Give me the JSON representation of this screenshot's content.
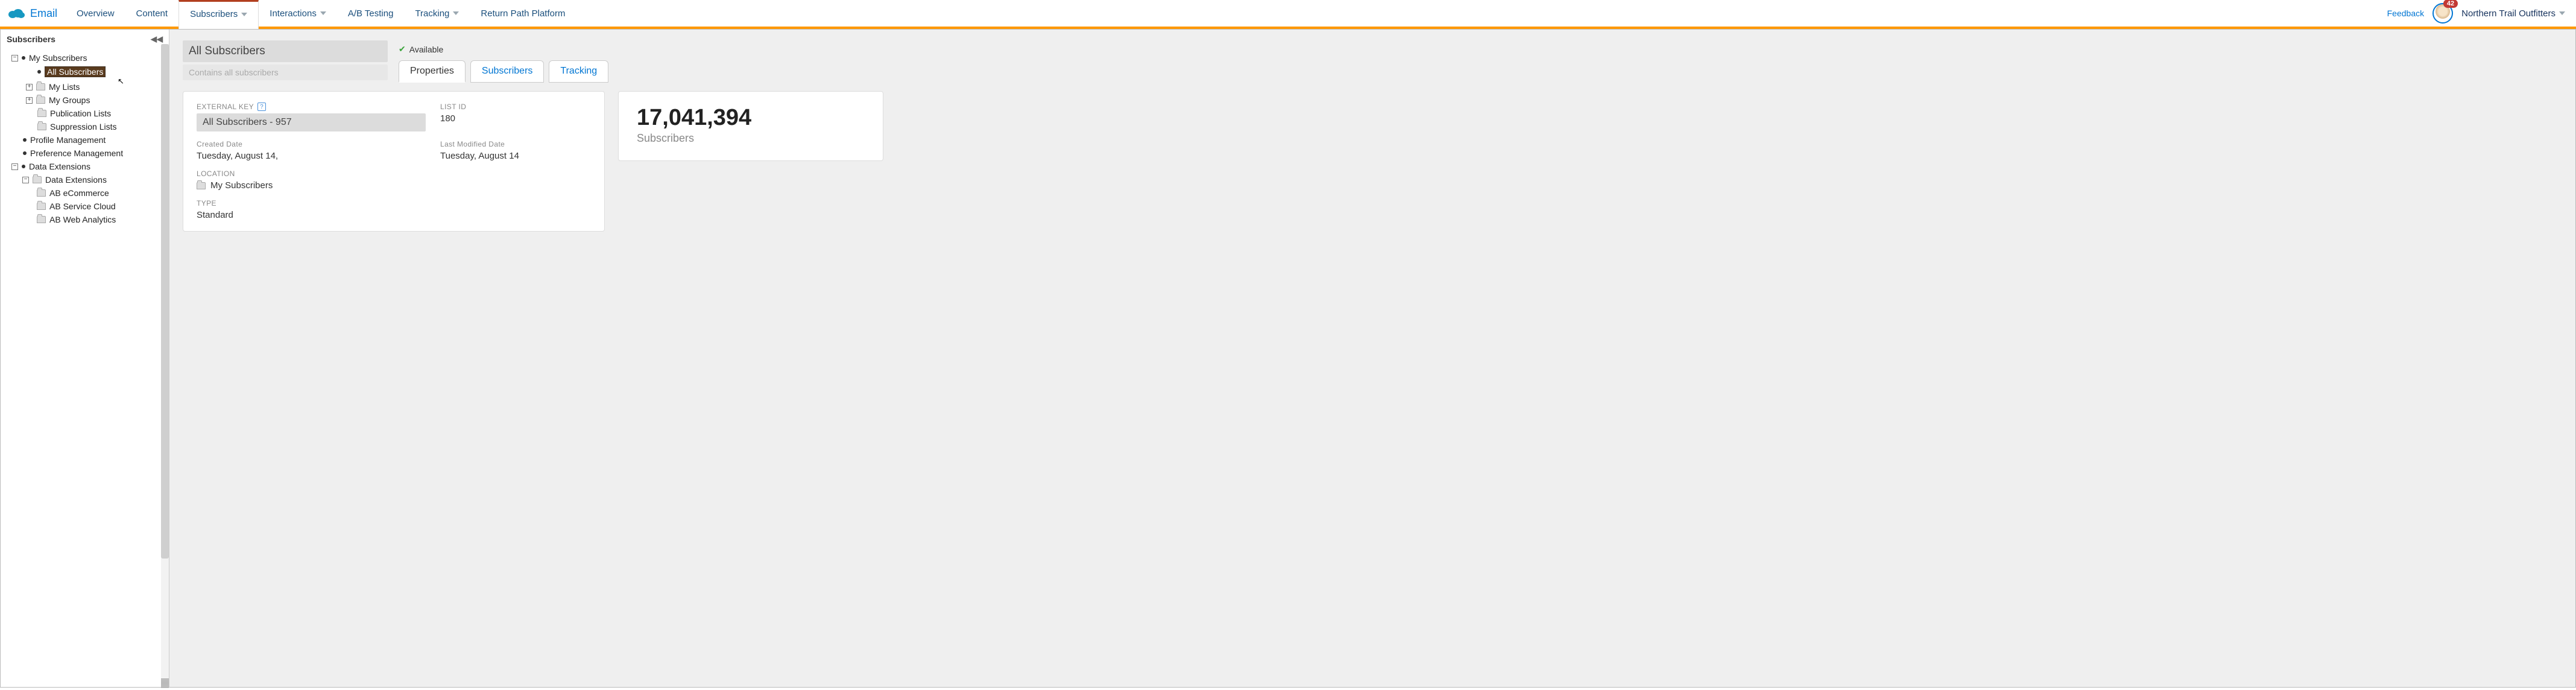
{
  "app_name": "Email",
  "nav": {
    "tabs": [
      {
        "label": "Overview",
        "dropdown": false
      },
      {
        "label": "Content",
        "dropdown": false
      },
      {
        "label": "Subscribers",
        "dropdown": true,
        "active": true
      },
      {
        "label": "Interactions",
        "dropdown": true
      },
      {
        "label": "A/B Testing",
        "dropdown": false
      },
      {
        "label": "Tracking",
        "dropdown": true
      },
      {
        "label": "Return Path Platform",
        "dropdown": false
      }
    ],
    "feedback": "Feedback",
    "badge": "42",
    "org": "Northern Trail Outfitters"
  },
  "sidebar": {
    "title": "Subscribers",
    "tree": {
      "my_subscribers": "My Subscribers",
      "all_subscribers": "All Subscribers",
      "my_lists": "My Lists",
      "my_groups": "My Groups",
      "publication_lists": "Publication Lists",
      "suppression_lists": "Suppression Lists",
      "profile_management": "Profile Management",
      "preference_management": "Preference Management",
      "data_extensions_root": "Data Extensions",
      "data_extensions": "Data Extensions",
      "ab_ecommerce": "AB eCommerce",
      "ab_service_cloud": "AB Service Cloud",
      "ab_web_analytics": "AB Web Analytics"
    }
  },
  "content": {
    "title": "All Subscribers",
    "subtitle": "Contains all subscribers",
    "status": "Available",
    "tabs": {
      "properties": "Properties",
      "subscribers": "Subscribers",
      "tracking": "Tracking"
    },
    "props": {
      "external_key_label": "EXTERNAL KEY",
      "external_key": "All Subscribers - 957",
      "list_id_label": "LIST ID",
      "list_id": "180",
      "created_label": "Created Date",
      "created": "Tuesday, August 14,",
      "modified_label": "Last Modified Date",
      "modified": "Tuesday, August 14",
      "location_label": "LOCATION",
      "location": "My Subscribers",
      "type_label": "TYPE",
      "type": "Standard"
    },
    "count": {
      "value": "17,041,394",
      "label": "Subscribers"
    }
  }
}
